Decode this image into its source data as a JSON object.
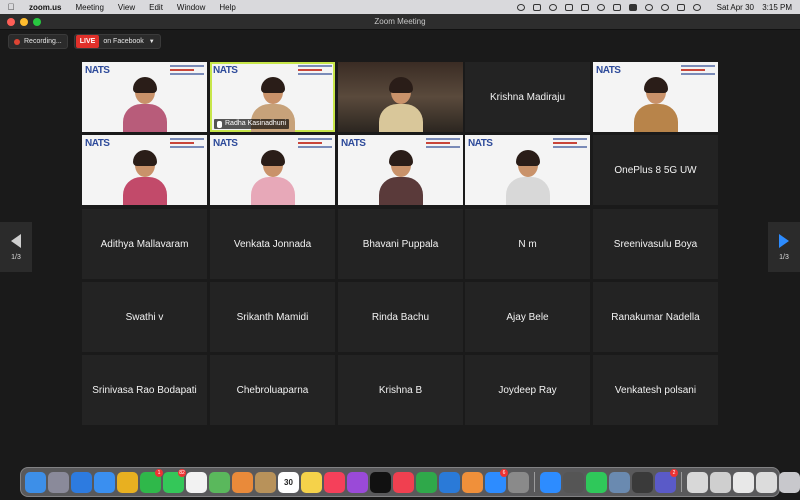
{
  "menubar": {
    "app": "zoom.us",
    "items": [
      "Meeting",
      "View",
      "Edit",
      "Window",
      "Help"
    ],
    "date": "Sat Apr 30",
    "time": "3:15 PM"
  },
  "window": {
    "title": "Zoom Meeting"
  },
  "status": {
    "recording": "Recording...",
    "live": "LIVE",
    "live_target": "on Facebook"
  },
  "pager": {
    "left": "1/3",
    "right": "1/3"
  },
  "logo_text": "NATS",
  "video_tiles": [
    {
      "row": 0,
      "col": 0,
      "label": "",
      "style": "light",
      "shirt": "#b85c7a"
    },
    {
      "row": 0,
      "col": 1,
      "label": "Radha Kasinadhuni",
      "style": "light",
      "speaking": true,
      "shirt": "#c7a27a"
    },
    {
      "row": 0,
      "col": 2,
      "label": "",
      "style": "dark",
      "shirt": "#d9c79a"
    },
    {
      "row": 0,
      "col": 4,
      "label": "",
      "style": "light",
      "shirt": "#b8844a"
    },
    {
      "row": 1,
      "col": 0,
      "label": "",
      "style": "light",
      "shirt": "#c24a6a"
    },
    {
      "row": 1,
      "col": 1,
      "label": "",
      "style": "light",
      "shirt": "#e7a8b8"
    },
    {
      "row": 1,
      "col": 2,
      "label": "",
      "style": "light",
      "shirt": "#5a3a3a"
    },
    {
      "row": 1,
      "col": 3,
      "label": "",
      "style": "light",
      "shirt": "#d8d8d8"
    }
  ],
  "name_tiles": [
    {
      "row": 0,
      "col": 3,
      "name": "Krishna Madiraju"
    },
    {
      "row": 1,
      "col": 4,
      "name": "OnePlus 8 5G UW"
    },
    {
      "row": 2,
      "col": 0,
      "name": "Adithya Mallavaram"
    },
    {
      "row": 2,
      "col": 1,
      "name": "Venkata Jonnada"
    },
    {
      "row": 2,
      "col": 2,
      "name": "Bhavani Puppala"
    },
    {
      "row": 2,
      "col": 3,
      "name": "N m"
    },
    {
      "row": 2,
      "col": 4,
      "name": "Sreenivasulu Boya"
    },
    {
      "row": 3,
      "col": 0,
      "name": "Swathi v"
    },
    {
      "row": 3,
      "col": 1,
      "name": "Srikanth Mamidi"
    },
    {
      "row": 3,
      "col": 2,
      "name": "Rinda Bachu"
    },
    {
      "row": 3,
      "col": 3,
      "name": "Ajay Bele"
    },
    {
      "row": 3,
      "col": 4,
      "name": "Ranakumar Nadella"
    },
    {
      "row": 4,
      "col": 0,
      "name": "Srinivasa Rao Bodapati"
    },
    {
      "row": 4,
      "col": 1,
      "name": "Chebroluaparna"
    },
    {
      "row": 4,
      "col": 2,
      "name": "Krishna B"
    },
    {
      "row": 4,
      "col": 3,
      "name": "Joydeep Ray"
    },
    {
      "row": 4,
      "col": 4,
      "name": "Venkatesh polsani"
    }
  ],
  "dock": [
    {
      "name": "finder-icon",
      "color": "#3d8fe8"
    },
    {
      "name": "launchpad-icon",
      "color": "#8a8a9a"
    },
    {
      "name": "safari-icon",
      "color": "#2d7be0"
    },
    {
      "name": "mail-icon",
      "color": "#3a8ff0"
    },
    {
      "name": "chrome-icon",
      "color": "#e8b020"
    },
    {
      "name": "facetime-icon",
      "color": "#2fb84a",
      "badge": "1"
    },
    {
      "name": "messages-icon",
      "color": "#34c759",
      "badge": "82"
    },
    {
      "name": "reminders-icon",
      "color": "#f2f2f2"
    },
    {
      "name": "maps-icon",
      "color": "#5ab85c"
    },
    {
      "name": "photos-icon",
      "color": "#e98a3a"
    },
    {
      "name": "contacts-icon",
      "color": "#b8925a"
    },
    {
      "name": "calendar-icon",
      "color": "#ffffff",
      "glyph": "30"
    },
    {
      "name": "notes-icon",
      "color": "#f5d24a"
    },
    {
      "name": "music-icon",
      "color": "#f5405a"
    },
    {
      "name": "podcasts-icon",
      "color": "#9a4ad8"
    },
    {
      "name": "tv-icon",
      "color": "#111111"
    },
    {
      "name": "news-icon",
      "color": "#f04050"
    },
    {
      "name": "numbers-icon",
      "color": "#2fa84a"
    },
    {
      "name": "keynote-icon",
      "color": "#2a7ad8"
    },
    {
      "name": "pages-icon",
      "color": "#f0903a"
    },
    {
      "name": "app-store-icon",
      "color": "#2d8cff",
      "badge": "6"
    },
    {
      "name": "system-preferences-icon",
      "color": "#8a8a8a"
    },
    {
      "name": "sep"
    },
    {
      "name": "zoom-dock-icon",
      "color": "#2d8cff"
    },
    {
      "name": "camera-icon",
      "color": "#555555"
    },
    {
      "name": "whatsapp-icon",
      "color": "#2fc85a"
    },
    {
      "name": "preview-icon",
      "color": "#6a8ab0"
    },
    {
      "name": "quicktime-icon",
      "color": "#3a3a3a"
    },
    {
      "name": "teams-icon",
      "color": "#5a5ac8",
      "badge": "2"
    },
    {
      "name": "sep"
    },
    {
      "name": "window-thumb-icon",
      "color": "#d8d8d8"
    },
    {
      "name": "window-thumb-icon",
      "color": "#cfcfcf"
    },
    {
      "name": "window-thumb-icon",
      "color": "#e8e8e8"
    },
    {
      "name": "window-thumb-icon",
      "color": "#dcdcdc"
    },
    {
      "name": "trash-icon",
      "color": "#c8c8cc"
    }
  ]
}
